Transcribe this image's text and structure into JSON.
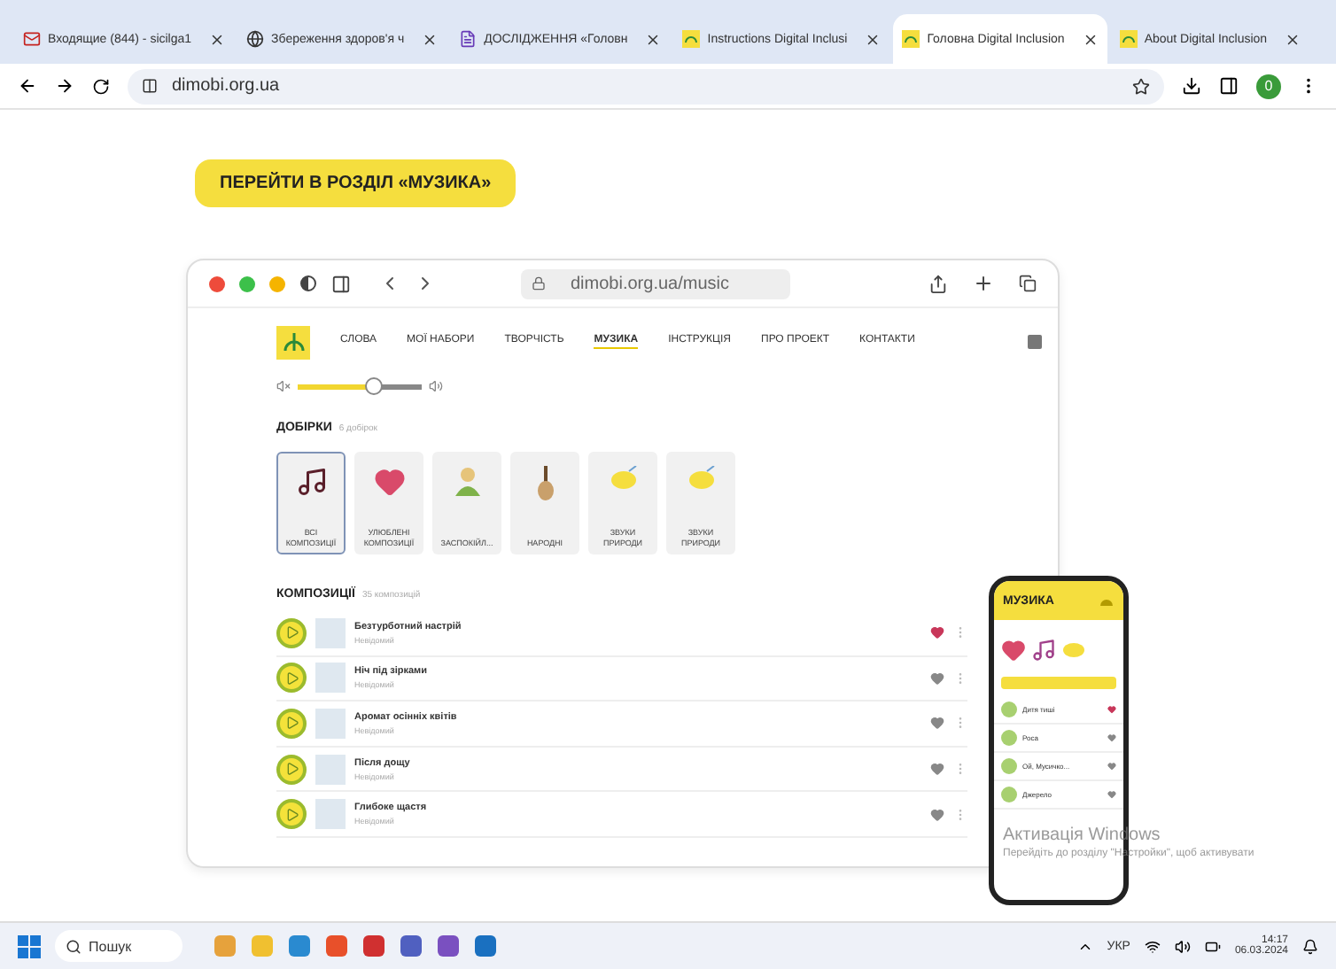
{
  "browser": {
    "tabs": [
      {
        "title": "Входящие (844) - sicilga1",
        "selected": false
      },
      {
        "title": "Збереження здоров'я ч",
        "selected": false
      },
      {
        "title": "ДОСЛІДЖЕННЯ «Головн",
        "selected": false
      },
      {
        "title": "Instructions Digital Inclusi",
        "selected": false
      },
      {
        "title": "Головна Digital Inclusion",
        "selected": true
      },
      {
        "title": "About Digital Inclusion",
        "selected": false
      }
    ],
    "address": "dimobi.org.ua",
    "profile": "0"
  },
  "page": {
    "cta": "ПЕРЕЙТИ В РОЗДІЛ «МУЗИКА»",
    "mockup": {
      "address": "dimobi.org.ua/music",
      "nav": [
        {
          "label": "СЛОВА",
          "selected": false
        },
        {
          "label": "МОЇ НАБОРИ",
          "selected": false
        },
        {
          "label": "ТВОРЧІСТЬ",
          "selected": false
        },
        {
          "label": "МУЗИКА",
          "selected": true
        },
        {
          "label": "ІНСТРУКЦІЯ",
          "selected": false
        },
        {
          "label": "ПРО ПРОЕКТ",
          "selected": false
        },
        {
          "label": "КОНТАКТИ",
          "selected": false
        }
      ],
      "volume": {
        "level": 0.62
      },
      "collections_title": "ДОБІРКИ",
      "collections_count": "6 добірок",
      "collections": [
        {
          "label": "ВСІ КОМПОЗИЦІЇ",
          "kind": "note",
          "selected": true
        },
        {
          "label": "УЛЮБЛЕНІ КОМПОЗИЦІЇ",
          "kind": "heart",
          "selected": false
        },
        {
          "label": "ЗАСПОКІЙЛ...",
          "kind": "person",
          "selected": false
        },
        {
          "label": "НАРОДНІ",
          "kind": "lute",
          "selected": false
        },
        {
          "label": "ЗВУКИ ПРИРОДИ",
          "kind": "bird",
          "selected": false
        },
        {
          "label": "ЗВУКИ ПРИРОДИ",
          "kind": "bird",
          "selected": false
        }
      ],
      "tracks_title": "КОМПОЗИЦІЇ",
      "tracks_count": "35 композицій",
      "tracks": [
        {
          "title": "Безтурботний настрій",
          "artist": "Невідомий",
          "favorite": true
        },
        {
          "title": "Ніч під зірками",
          "artist": "Невідомий",
          "favorite": false
        },
        {
          "title": "Аромат осінніх квітів",
          "artist": "Невідомий",
          "favorite": false
        },
        {
          "title": "Після дощу",
          "artist": "Невідомий",
          "favorite": false
        },
        {
          "title": "Глибоке щастя",
          "artist": "Невідомий",
          "favorite": false
        }
      ]
    },
    "phone": {
      "title": "МУЗИКА",
      "tracks": [
        {
          "title": "Дитя тиші",
          "favorite": true
        },
        {
          "title": "Роса",
          "favorite": false
        },
        {
          "title": "Ой, Мусичко...",
          "favorite": false
        },
        {
          "title": "Джерело",
          "favorite": false
        }
      ]
    }
  },
  "activation": {
    "title": "Активація Windows",
    "text": "Перейдіть до розділу \"Настройки\", щоб активувати"
  },
  "taskbar": {
    "search": "Пошук",
    "lang": "УКР",
    "time": "14:17",
    "date": "06.03.2024"
  }
}
